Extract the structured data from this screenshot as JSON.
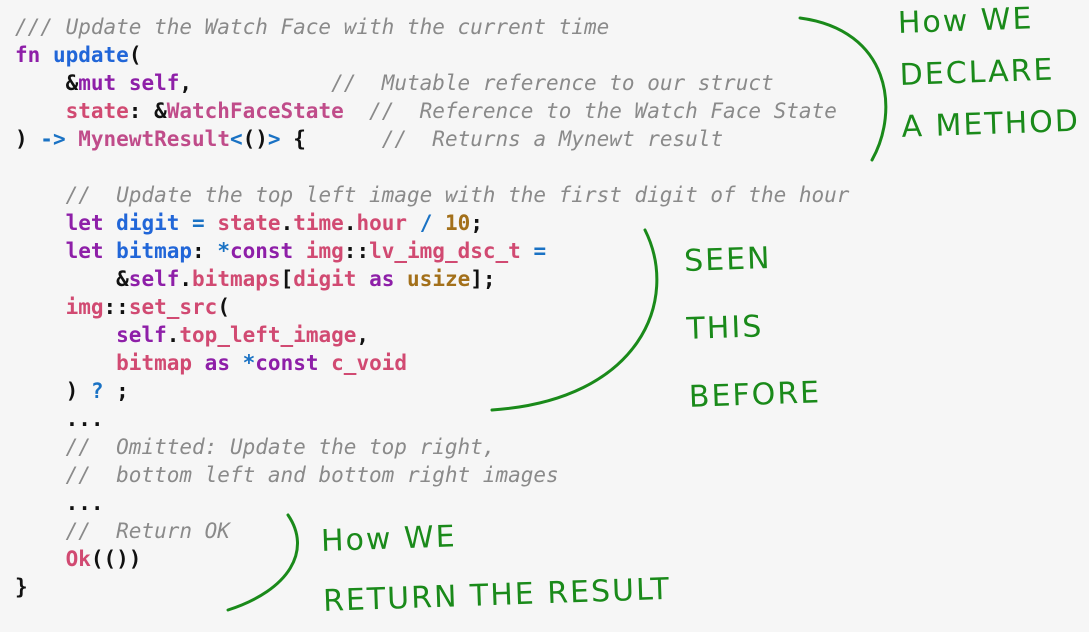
{
  "code_lines": [
    [
      [
        "c",
        "/// Update the Watch Face with the current time"
      ]
    ],
    [
      [
        "kw",
        "fn"
      ],
      [
        "pl",
        " "
      ],
      [
        "fn",
        "update"
      ],
      [
        "pl",
        "("
      ]
    ],
    [
      [
        "pl",
        "    "
      ],
      [
        "pl",
        "&"
      ],
      [
        "kw",
        "mut"
      ],
      [
        "pl",
        " "
      ],
      [
        "kw",
        "self"
      ],
      [
        "pl",
        ",           "
      ],
      [
        "c",
        "//  Mutable reference to our struct"
      ]
    ],
    [
      [
        "pl",
        "    "
      ],
      [
        "id",
        "state"
      ],
      [
        "pl",
        ": &"
      ],
      [
        "ty",
        "WatchFaceState"
      ],
      [
        "pl",
        "  "
      ],
      [
        "c",
        "//  Reference to the Watch Face State"
      ]
    ],
    [
      [
        "pl",
        ") "
      ],
      [
        "op",
        "->"
      ],
      [
        "pl",
        " "
      ],
      [
        "ty",
        "MynewtResult"
      ],
      [
        "op",
        "<"
      ],
      [
        "pl",
        "()"
      ],
      [
        "op",
        ">"
      ],
      [
        "pl",
        " {      "
      ],
      [
        "c",
        "//  Returns a Mynewt result"
      ]
    ],
    [
      [
        "pl",
        ""
      ]
    ],
    [
      [
        "pl",
        "    "
      ],
      [
        "c",
        "//  Update the top left image with the first digit of the hour"
      ]
    ],
    [
      [
        "pl",
        "    "
      ],
      [
        "kw",
        "let"
      ],
      [
        "pl",
        " "
      ],
      [
        "fn",
        "digit"
      ],
      [
        "pl",
        " "
      ],
      [
        "op",
        "="
      ],
      [
        "pl",
        " "
      ],
      [
        "id",
        "state"
      ],
      [
        "pl",
        "."
      ],
      [
        "id",
        "time"
      ],
      [
        "pl",
        "."
      ],
      [
        "id",
        "hour"
      ],
      [
        "pl",
        " "
      ],
      [
        "op",
        "/"
      ],
      [
        "pl",
        " "
      ],
      [
        "nu",
        "10"
      ],
      [
        "pl",
        ";"
      ]
    ],
    [
      [
        "pl",
        "    "
      ],
      [
        "kw",
        "let"
      ],
      [
        "pl",
        " "
      ],
      [
        "fn",
        "bitmap"
      ],
      [
        "pl",
        ": "
      ],
      [
        "op",
        "*"
      ],
      [
        "kw",
        "const"
      ],
      [
        "pl",
        " "
      ],
      [
        "id",
        "img"
      ],
      [
        "pl",
        "::"
      ],
      [
        "id",
        "lv_img_dsc_t"
      ],
      [
        "pl",
        " "
      ],
      [
        "op",
        "="
      ]
    ],
    [
      [
        "pl",
        "        &"
      ],
      [
        "kw",
        "self"
      ],
      [
        "pl",
        "."
      ],
      [
        "id",
        "bitmaps"
      ],
      [
        "pl",
        "["
      ],
      [
        "id",
        "digit"
      ],
      [
        "pl",
        " "
      ],
      [
        "kw",
        "as"
      ],
      [
        "pl",
        " "
      ],
      [
        "nu",
        "usize"
      ],
      [
        "pl",
        "];"
      ]
    ],
    [
      [
        "pl",
        "    "
      ],
      [
        "id",
        "img"
      ],
      [
        "pl",
        "::"
      ],
      [
        "id",
        "set_src"
      ],
      [
        "pl",
        "("
      ]
    ],
    [
      [
        "pl",
        "        "
      ],
      [
        "kw",
        "self"
      ],
      [
        "pl",
        "."
      ],
      [
        "id",
        "top_left_image"
      ],
      [
        "pl",
        ","
      ]
    ],
    [
      [
        "pl",
        "        "
      ],
      [
        "id",
        "bitmap"
      ],
      [
        "pl",
        " "
      ],
      [
        "kw",
        "as"
      ],
      [
        "pl",
        " "
      ],
      [
        "op",
        "*"
      ],
      [
        "kw",
        "const"
      ],
      [
        "pl",
        " "
      ],
      [
        "id",
        "c_void"
      ]
    ],
    [
      [
        "pl",
        "    ) "
      ],
      [
        "op",
        "?"
      ],
      [
        "pl",
        " ;"
      ]
    ],
    [
      [
        "pl",
        "    ..."
      ]
    ],
    [
      [
        "pl",
        "    "
      ],
      [
        "c",
        "//  Omitted: Update the top right,"
      ]
    ],
    [
      [
        "pl",
        "    "
      ],
      [
        "c",
        "//  bottom left and bottom right images"
      ]
    ],
    [
      [
        "pl",
        "    ..."
      ]
    ],
    [
      [
        "pl",
        "    "
      ],
      [
        "c",
        "//  Return OK"
      ]
    ],
    [
      [
        "pl",
        "    "
      ],
      [
        "id",
        "Ok"
      ],
      [
        "pl",
        "(())"
      ]
    ],
    [
      [
        "pl",
        "}"
      ]
    ]
  ],
  "notes": {
    "declare": [
      "How WE",
      "DECLARE",
      "A METHOD"
    ],
    "seen": [
      "SEEN",
      "THIS",
      "BEFORE"
    ],
    "return": [
      "How WE",
      "RETURN THE RESULT"
    ]
  },
  "colors": {
    "comment": "#8a8a8a",
    "keyword": "#8e1fa8",
    "function": "#2166d8",
    "identifier": "#d14a72",
    "number": "#a3701a",
    "annotation": "#1a8a1a"
  }
}
